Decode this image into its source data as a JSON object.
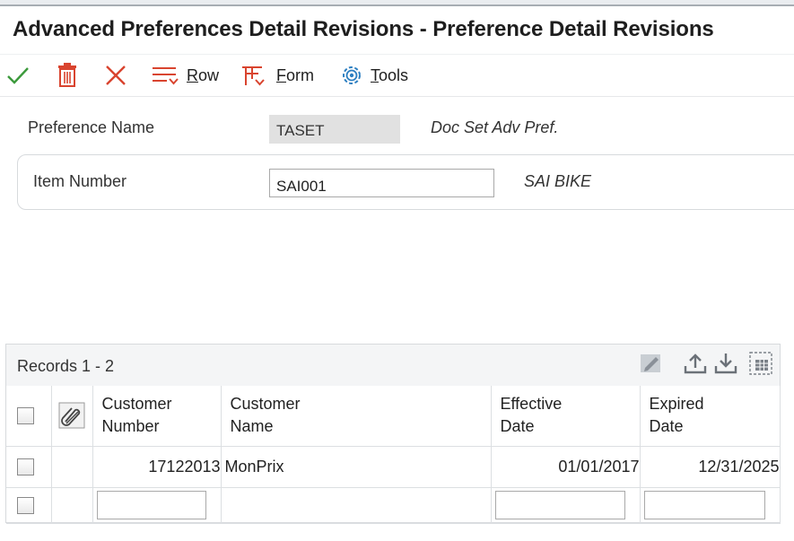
{
  "window": {
    "title": "Advanced Preferences Detail Revisions - Preference Detail Revisions"
  },
  "toolbar": {
    "ok_icon": "checkmark-icon",
    "delete_icon": "trash-icon",
    "cancel_icon": "close-icon",
    "row_label_ul": "R",
    "row_label_rest": "ow",
    "form_label_ul": "F",
    "form_label_rest": "orm",
    "tools_label_ul": "T",
    "tools_label_rest": "ools"
  },
  "form": {
    "preference_name_label": "Preference Name",
    "preference_name_value": "TASET",
    "preference_name_desc": "Doc Set Adv Pref.",
    "item_number_label": "Item Number",
    "item_number_value": "SAI001",
    "item_number_desc": "SAI BIKE"
  },
  "grid": {
    "records_label": "Records 1 - 2",
    "columns": [
      {
        "line1": "Customer",
        "line2": "Number"
      },
      {
        "line1": "Customer",
        "line2": "Name"
      },
      {
        "line1": "Effective",
        "line2": "Date"
      },
      {
        "line1": "Expired",
        "line2": "Date"
      }
    ],
    "rows": [
      {
        "customer_number": "17122013",
        "customer_name": "MonPrix",
        "effective_date": "01/01/2017",
        "expired_date": "12/31/2025"
      }
    ]
  },
  "colors": {
    "accent_red": "#d9442f",
    "ok_green": "#3c9a3c",
    "tools_blue": "#2d7fc1"
  }
}
